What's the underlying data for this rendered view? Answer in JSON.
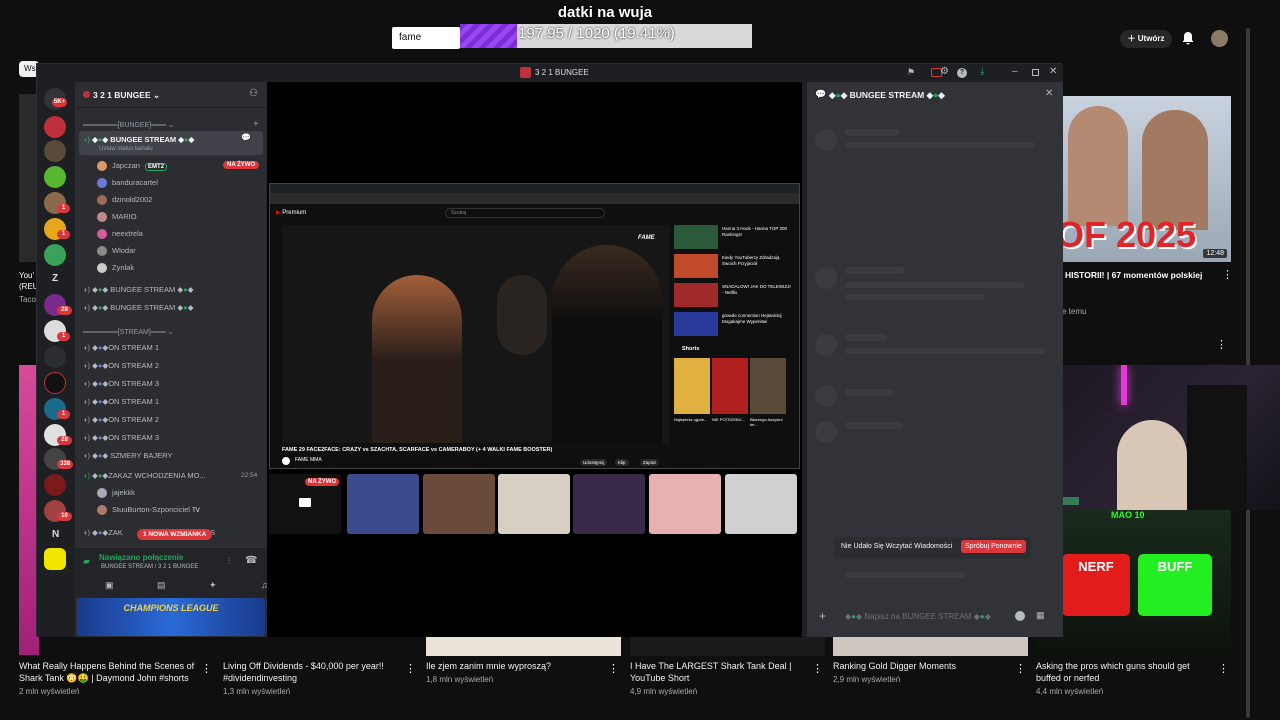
{
  "overlay": {
    "title": "datki na wuja",
    "label": "fame",
    "progress_text": "197.95 / 1020 (19.41%)",
    "progress_fraction": 0.1941
  },
  "yt_header": {
    "create_label": "Utwórz"
  },
  "window": {
    "title": "3 2 1 BUNGEE"
  },
  "server": {
    "name": "3 2 1 BUNGEE",
    "badges": [
      "5K+",
      "1",
      "1",
      "28",
      "1",
      "1",
      "28",
      "338",
      "10"
    ]
  },
  "channels": {
    "cat1": "BUNGEE",
    "voice_main": "BUNGEE STREAM",
    "status_hint": "Ustaw status kanału",
    "live_badge": "NA ŻYWO",
    "users": [
      "Japczan",
      "banduracartel",
      "dzinold2002",
      "MARIO",
      "neextrela",
      "Wlodar",
      "Zynlak"
    ],
    "user_tag": "EMT2",
    "extra_voice": [
      "BUNGEE STREAM",
      "BUNGEE STREAM"
    ],
    "cat2": "STREAM",
    "stream_channels": [
      "ON STREAM 1",
      "ON STREAM 2",
      "ON STREAM 3",
      "ON STREAM 1",
      "ON STREAM 2",
      "ON STREAM 3",
      "SZMERY BAJERY"
    ],
    "zakaz": "ZAKAZ WCHODZENIA MO...",
    "zakaz_time": "22:54",
    "zakaz_users": [
      "jajekkk",
      "StuuBurton-Szponciciel"
    ],
    "zakaz_tag": "TV",
    "mods_prefix": "ZAK",
    "mods_suffix": "MODS",
    "mention_pill": "1 NOWA WZMIANKA",
    "connected": "Nawiązano połączenie",
    "connected_sub": "BUNGEE STREAM / 3 2 1 BUNGEE",
    "banner": "CHAMPIONS LEAGUE"
  },
  "stage": {
    "video_title": "FAME 29 FACE2FACE: CRAZY vs SZACHTA, SCARFACE vs CAMERABOY (+ 4 WALKI FAME BOOSTER)",
    "channel": "FAME MMA",
    "watermark": "FAME",
    "search_placeholder": "Szukaj",
    "side_items": [
      "Hanna 3 Hook - Hanna TOP 200 Rankings!",
      "Kiedy YouTuberzy Zdradzają Swoich Przyjaciół",
      "SNADALOW! JAK DO TELEWIZJI - Netflix",
      "growde connection Hejtanickij Mogakajme Wypenitwi"
    ],
    "shorts_label": "Shorts",
    "shorts": [
      "Najlepiesz ujęcie...",
      "NIE POTRZEBU...",
      "Błazengo Assystul ter..."
    ],
    "actions": [
      "Udostępnij",
      "Klip",
      "Zapisz"
    ],
    "live_pill": "NA ŻYWO"
  },
  "chat": {
    "channel": "BUNGEE STREAM",
    "error": "Nie Udało Się Wczytać Wiadomości",
    "retry": "Spróbuj Ponownie",
    "input_placeholder": "Napisz na BUNGEE STREAM"
  },
  "right_panel": {
    "thumb_text": "OF 2025",
    "duration": "12:48",
    "video_title": "HISTORII! | 67 momentów polskiej",
    "sub": "e temu",
    "nerf": "NERF",
    "buff": "BUFF",
    "mao": "MAO 10"
  },
  "left_partial": {
    "chip": "Wsz",
    "t1": "You'",
    "t2": "(REU",
    "t3": "Taco"
  },
  "bottom_videos": [
    {
      "title": "What Really Happens Behind the Scenes of Shark Tank 😳🤑 | Daymond John #shorts",
      "views": "2 mln wyświetleń"
    },
    {
      "title": "Living Off Dividends - $40,000 per year!! #dividendinvesting",
      "views": "1,3 mln wyświetleń"
    },
    {
      "title": "Ile zjem zanim mnie wyproszą?",
      "views": "1,8 mln wyświetleń"
    },
    {
      "title": "I Have The LARGEST Shark Tank Deal | YouTube Short",
      "views": "4,9 mln wyświetleń"
    },
    {
      "title": "Ranking Gold Digger Moments",
      "views": "2,9 mln wyświetleń"
    },
    {
      "title": "Asking the pros which guns should get buffed or nerfed",
      "views": "4,4 mln wyświetleń"
    }
  ]
}
